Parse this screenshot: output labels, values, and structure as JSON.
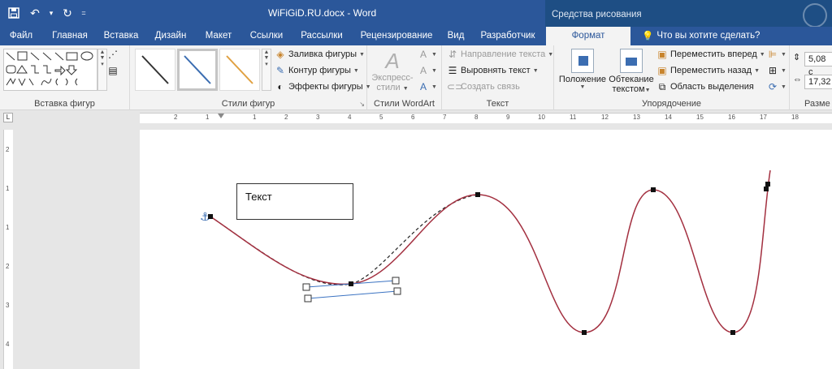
{
  "app": {
    "doc_title": "WiFiGiD.RU.docx - Word",
    "context_title": "Средства рисования"
  },
  "tabs": [
    "Файл",
    "Главная",
    "Вставка",
    "Дизайн",
    "Макет",
    "Ссылки",
    "Рассылки",
    "Рецензирование",
    "Вид",
    "Разработчик",
    "Формат"
  ],
  "active_tab": "Формат",
  "tell_me": "Что вы хотите сделать?",
  "ribbon": {
    "insert_shapes": {
      "label": "Вставка фигур"
    },
    "shape_styles": {
      "label": "Стили фигур",
      "fill": "Заливка фигуры",
      "outline": "Контур фигуры",
      "effects": "Эффекты фигуры"
    },
    "wordart": {
      "label": "Стили WordArt",
      "express_line1": "Экспресс-",
      "express_line2": "стили"
    },
    "text": {
      "label": "Текст",
      "direction": "Направление текста",
      "align": "Выровнять текст",
      "link": "Создать связь"
    },
    "arrange": {
      "label": "Упорядочение",
      "position": "Положение",
      "wrap_line1": "Обтекание",
      "wrap_line2": "текстом",
      "forward": "Переместить вперед",
      "backward": "Переместить назад",
      "selection": "Область выделения"
    },
    "size": {
      "label": "Разме",
      "height": "5,08 с",
      "width": "17,32"
    }
  },
  "ruler": {
    "h_numbers": [
      "2",
      "1",
      "1",
      "2",
      "3",
      "4",
      "5",
      "6",
      "7",
      "8",
      "9",
      "10",
      "11",
      "12",
      "13",
      "14",
      "15",
      "16",
      "17",
      "18"
    ],
    "v_numbers": [
      "2",
      "1",
      "1",
      "2",
      "3",
      "4"
    ]
  },
  "document": {
    "textbox_text": "Текст"
  },
  "colors": {
    "title_bar": "#2b579a",
    "context_bar": "#1e4e84",
    "curve": "#a33040",
    "handle_line": "#3b73c2"
  }
}
